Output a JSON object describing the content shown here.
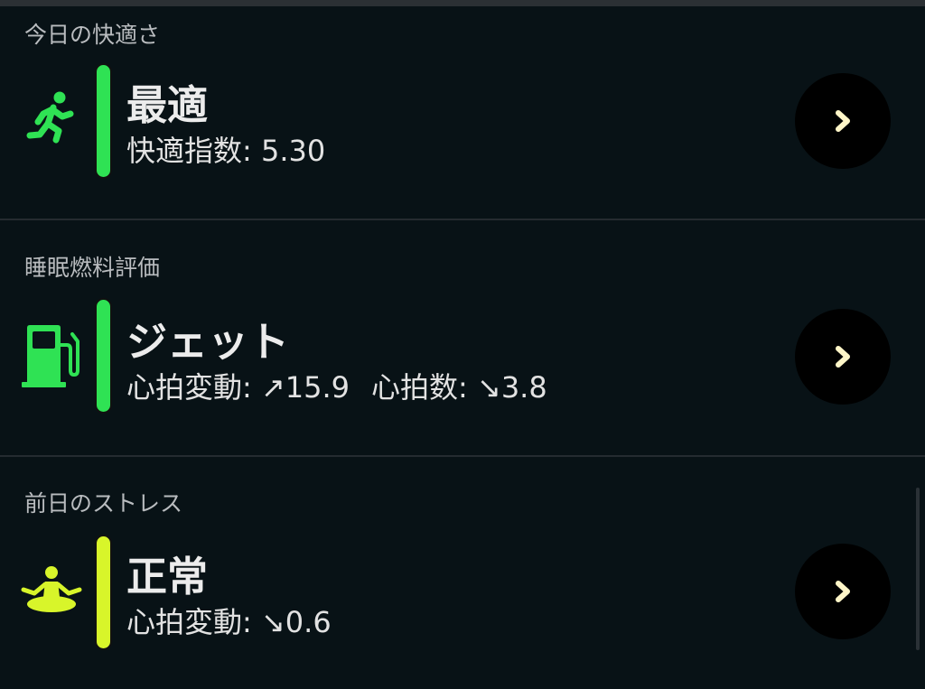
{
  "sections": [
    {
      "title": "今日の快適さ",
      "icon": "running-person-icon",
      "accent_color": "#2fe254",
      "status": "最適",
      "metrics": [
        {
          "label": "快適指数:",
          "value": "5.30"
        }
      ]
    },
    {
      "title": "睡眠燃料評価",
      "icon": "fuel-pump-icon",
      "accent_color": "#2fe254",
      "status": "ジェット",
      "metrics": [
        {
          "label": "心拍変動:",
          "value": "↗15.9"
        },
        {
          "label": "心拍数:",
          "value": "↘3.8"
        }
      ]
    },
    {
      "title": "前日のストレス",
      "icon": "meditation-icon",
      "accent_color": "#d8f52a",
      "status": "正常",
      "metrics": [
        {
          "label": "心拍変動:",
          "value": "↘0.6"
        }
      ]
    }
  ],
  "chevron_icon": "chevron-right-icon",
  "chevron_color": "#fff6c8"
}
